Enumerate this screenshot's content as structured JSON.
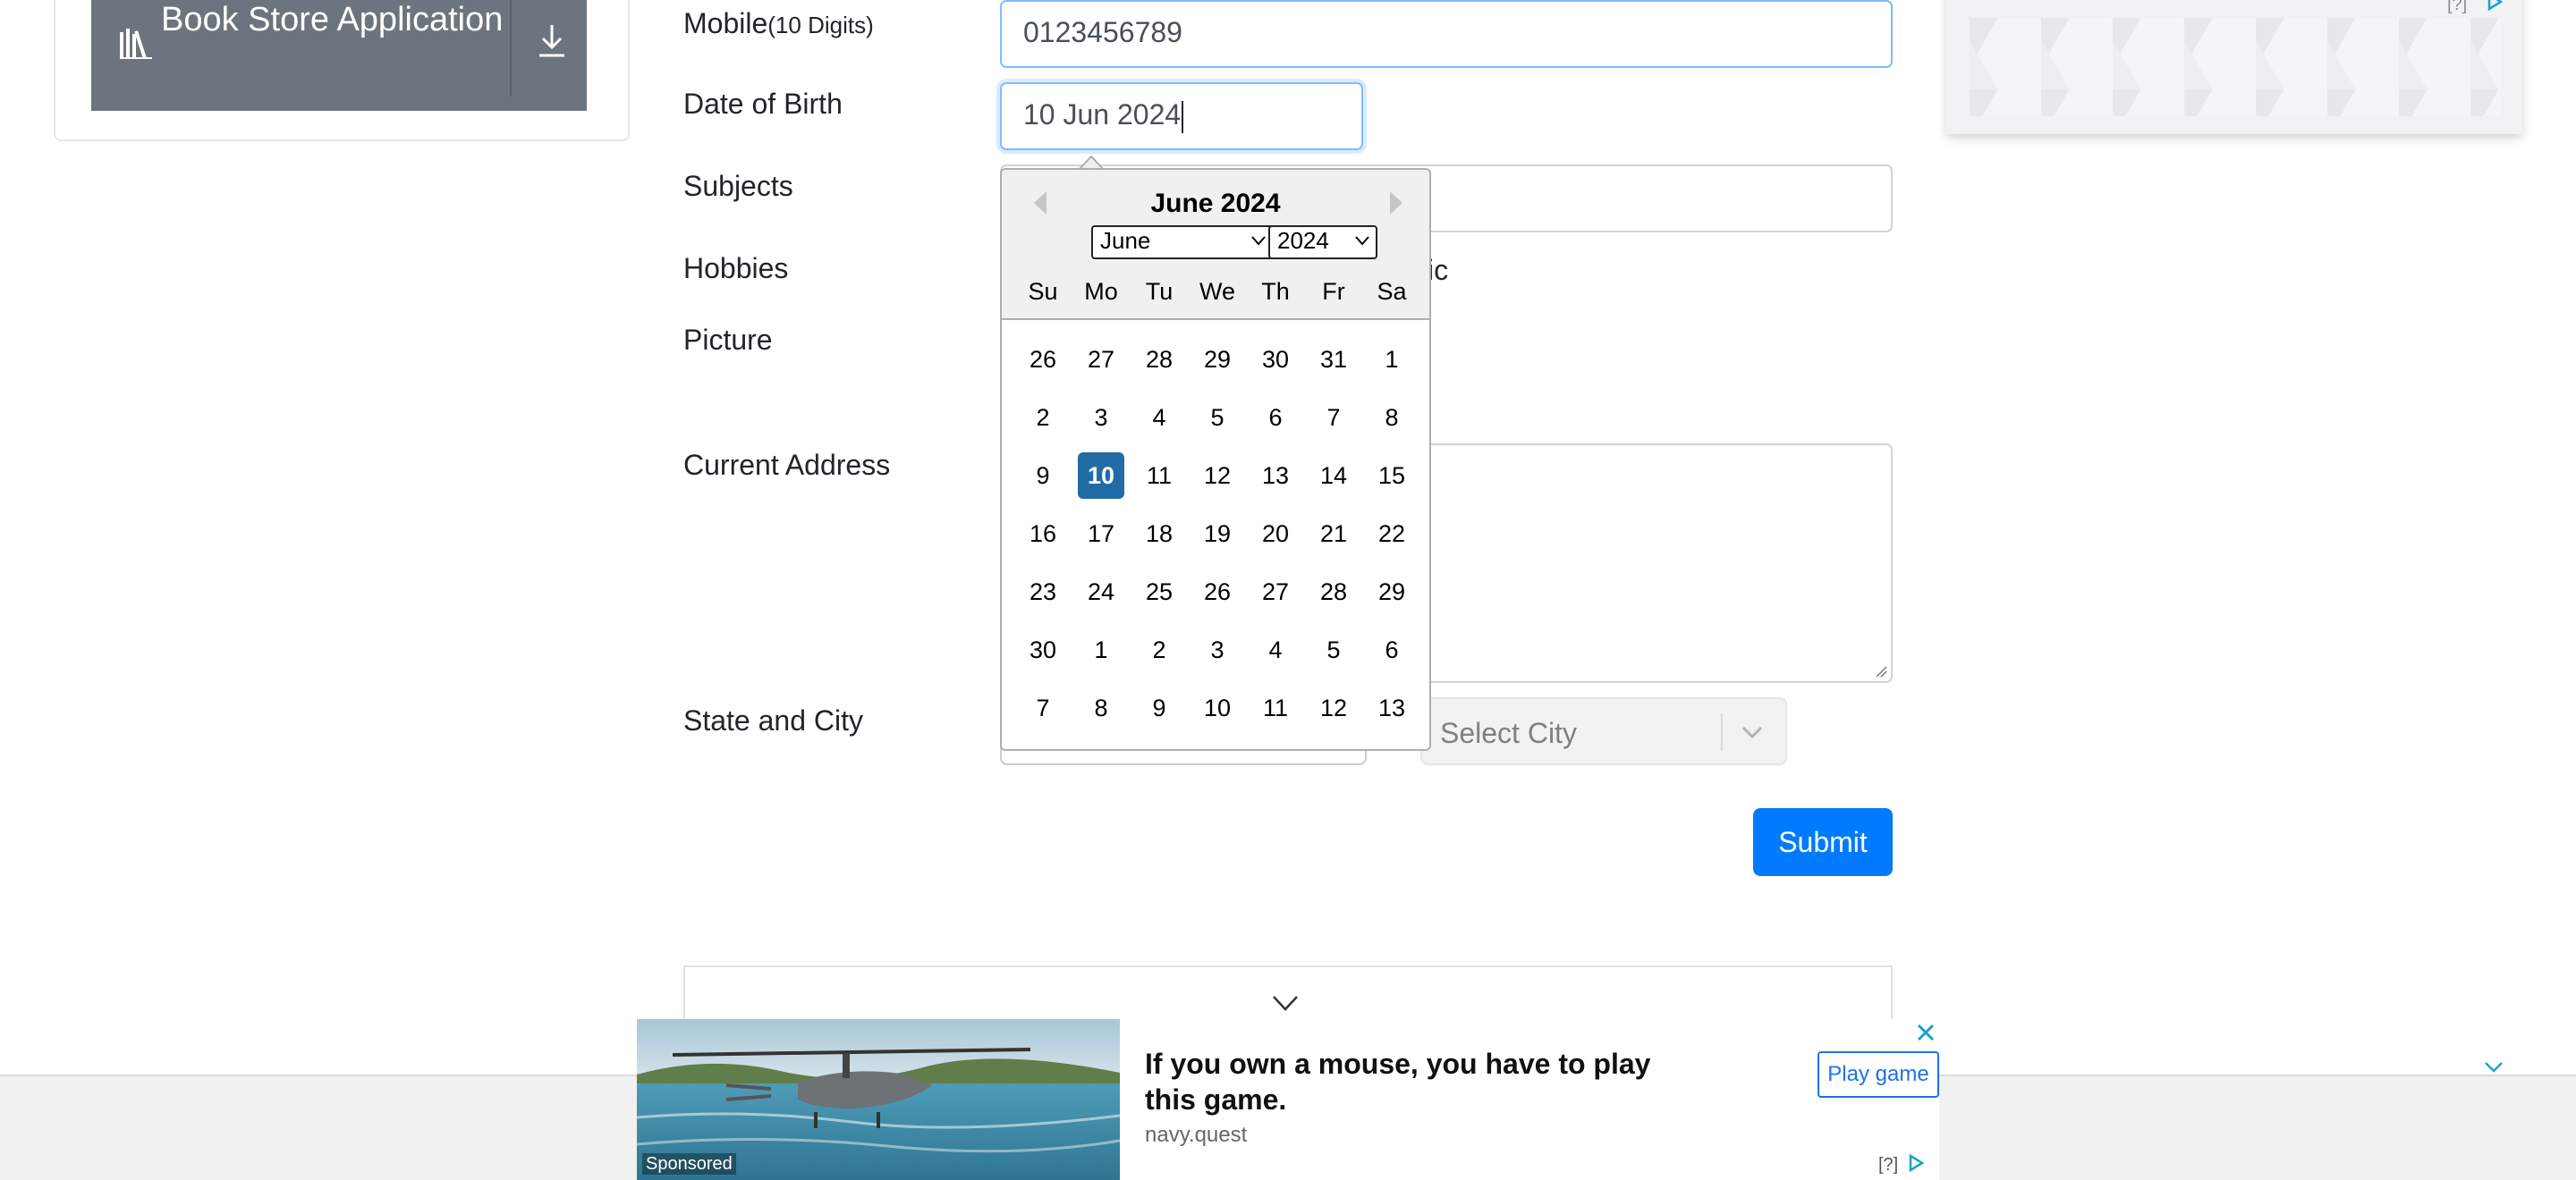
{
  "sidebar": {
    "book_store_label": "Book Store Application"
  },
  "form": {
    "mobile_label": "Mobile",
    "mobile_hint": "(10 Digits)",
    "mobile_value": "0123456789",
    "dob_label": "Date of Birth",
    "dob_value": "10 Jun 2024",
    "subjects_label": "Subjects",
    "hobbies_label": "Hobbies",
    "hobbies_partial": "ic",
    "picture_label": "Picture",
    "address_label": "Current Address",
    "state_city_label": "State and City",
    "city_placeholder": "Select City",
    "submit_label": "Submit"
  },
  "datepicker": {
    "title": "June 2024",
    "month_select": "June",
    "year_select": "2024",
    "weekdays": [
      "Su",
      "Mo",
      "Tu",
      "We",
      "Th",
      "Fr",
      "Sa"
    ],
    "weeks": [
      [
        "26",
        "27",
        "28",
        "29",
        "30",
        "31",
        "1"
      ],
      [
        "2",
        "3",
        "4",
        "5",
        "6",
        "7",
        "8"
      ],
      [
        "9",
        "10",
        "11",
        "12",
        "13",
        "14",
        "15"
      ],
      [
        "16",
        "17",
        "18",
        "19",
        "20",
        "21",
        "22"
      ],
      [
        "23",
        "24",
        "25",
        "26",
        "27",
        "28",
        "29"
      ],
      [
        "30",
        "1",
        "2",
        "3",
        "4",
        "5",
        "6"
      ],
      [
        "7",
        "8",
        "9",
        "10",
        "11",
        "12",
        "13"
      ]
    ],
    "selected_day": "10",
    "selected_color": "#216ba5"
  },
  "ad_top": {
    "question": "[?]"
  },
  "ad_bottom": {
    "title": "If you own a mouse, you have to play this game.",
    "domain": "navy.quest",
    "sponsored": "Sponsored",
    "play_label": "Play game",
    "question": "[?]"
  },
  "colors": {
    "submit": "#007bff",
    "bookstore_bg": "#6c757d",
    "focus_border": "#80bdff"
  },
  "icons": [
    "books-icon",
    "download-icon",
    "chevron-left-icon",
    "chevron-right-icon",
    "chevron-down-icon",
    "close-icon",
    "adchoices-icon"
  ]
}
